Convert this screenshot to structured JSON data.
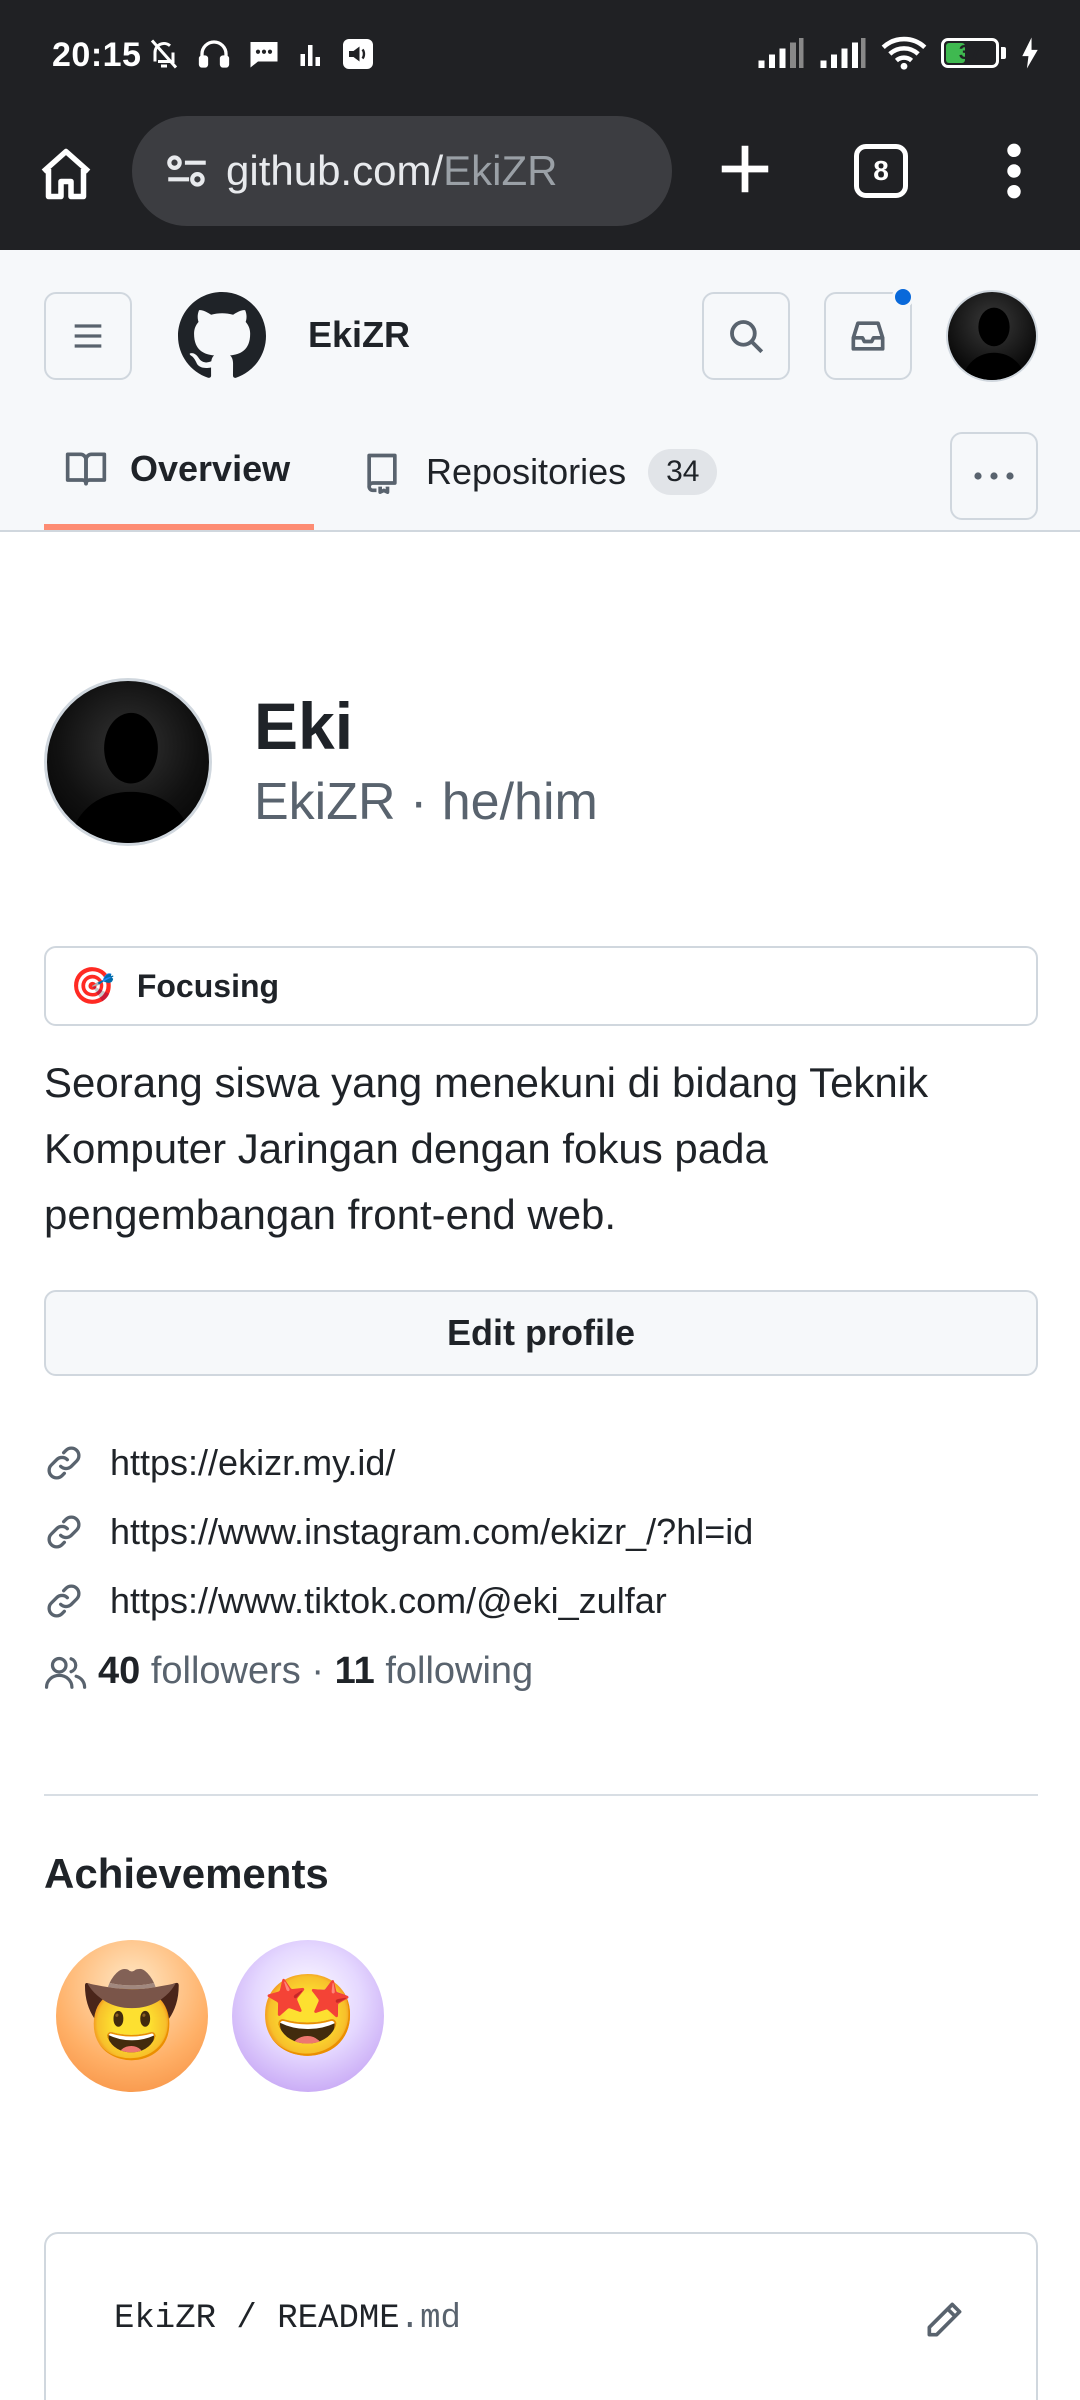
{
  "status_bar": {
    "time": "20:15",
    "battery_level": "37",
    "battery_fraction": 0.37,
    "icons": [
      "bell-off-icon",
      "headphones-icon",
      "message-icon",
      "bars-icon",
      "volume-icon",
      "signal-icon",
      "signal-icon",
      "wifi-icon",
      "battery-icon",
      "charging-icon"
    ]
  },
  "browser": {
    "url_host": "github.com/",
    "url_path": "EkiZR",
    "tab_count": "8"
  },
  "header": {
    "username": "EkiZR",
    "notification_color": "#0969da"
  },
  "tabs": [
    {
      "label": "Overview",
      "active": true
    },
    {
      "label": "Repositories",
      "count": "34",
      "active": false
    }
  ],
  "profile": {
    "name": "Eki",
    "subname": "EkiZR · he/him",
    "status_emoji": "🎯",
    "status_text": "Focusing",
    "bio": "Seorang siswa yang menekuni di bidang Teknik Komputer Jaringan dengan fokus pada pengembangan front-end web.",
    "edit_label": "Edit profile",
    "links": [
      "https://ekizr.my.id/",
      "https://www.instagram.com/ekizr_/?hl=id",
      "https://www.tiktok.com/@eki_zulfar"
    ],
    "followers_count": "40",
    "followers_label": "followers",
    "separator": " · ",
    "following_count": "11",
    "following_label": "following"
  },
  "achievements": {
    "title": "Achievements",
    "badges": [
      {
        "emoji": "🤠"
      },
      {
        "emoji": "🤩"
      }
    ]
  },
  "readme": {
    "owner": "EkiZR",
    "separator": " / ",
    "file": "README",
    "ext": ".md"
  },
  "colors": {
    "active_tab_underline": "#fd8c73",
    "muted_text": "#59636e"
  }
}
